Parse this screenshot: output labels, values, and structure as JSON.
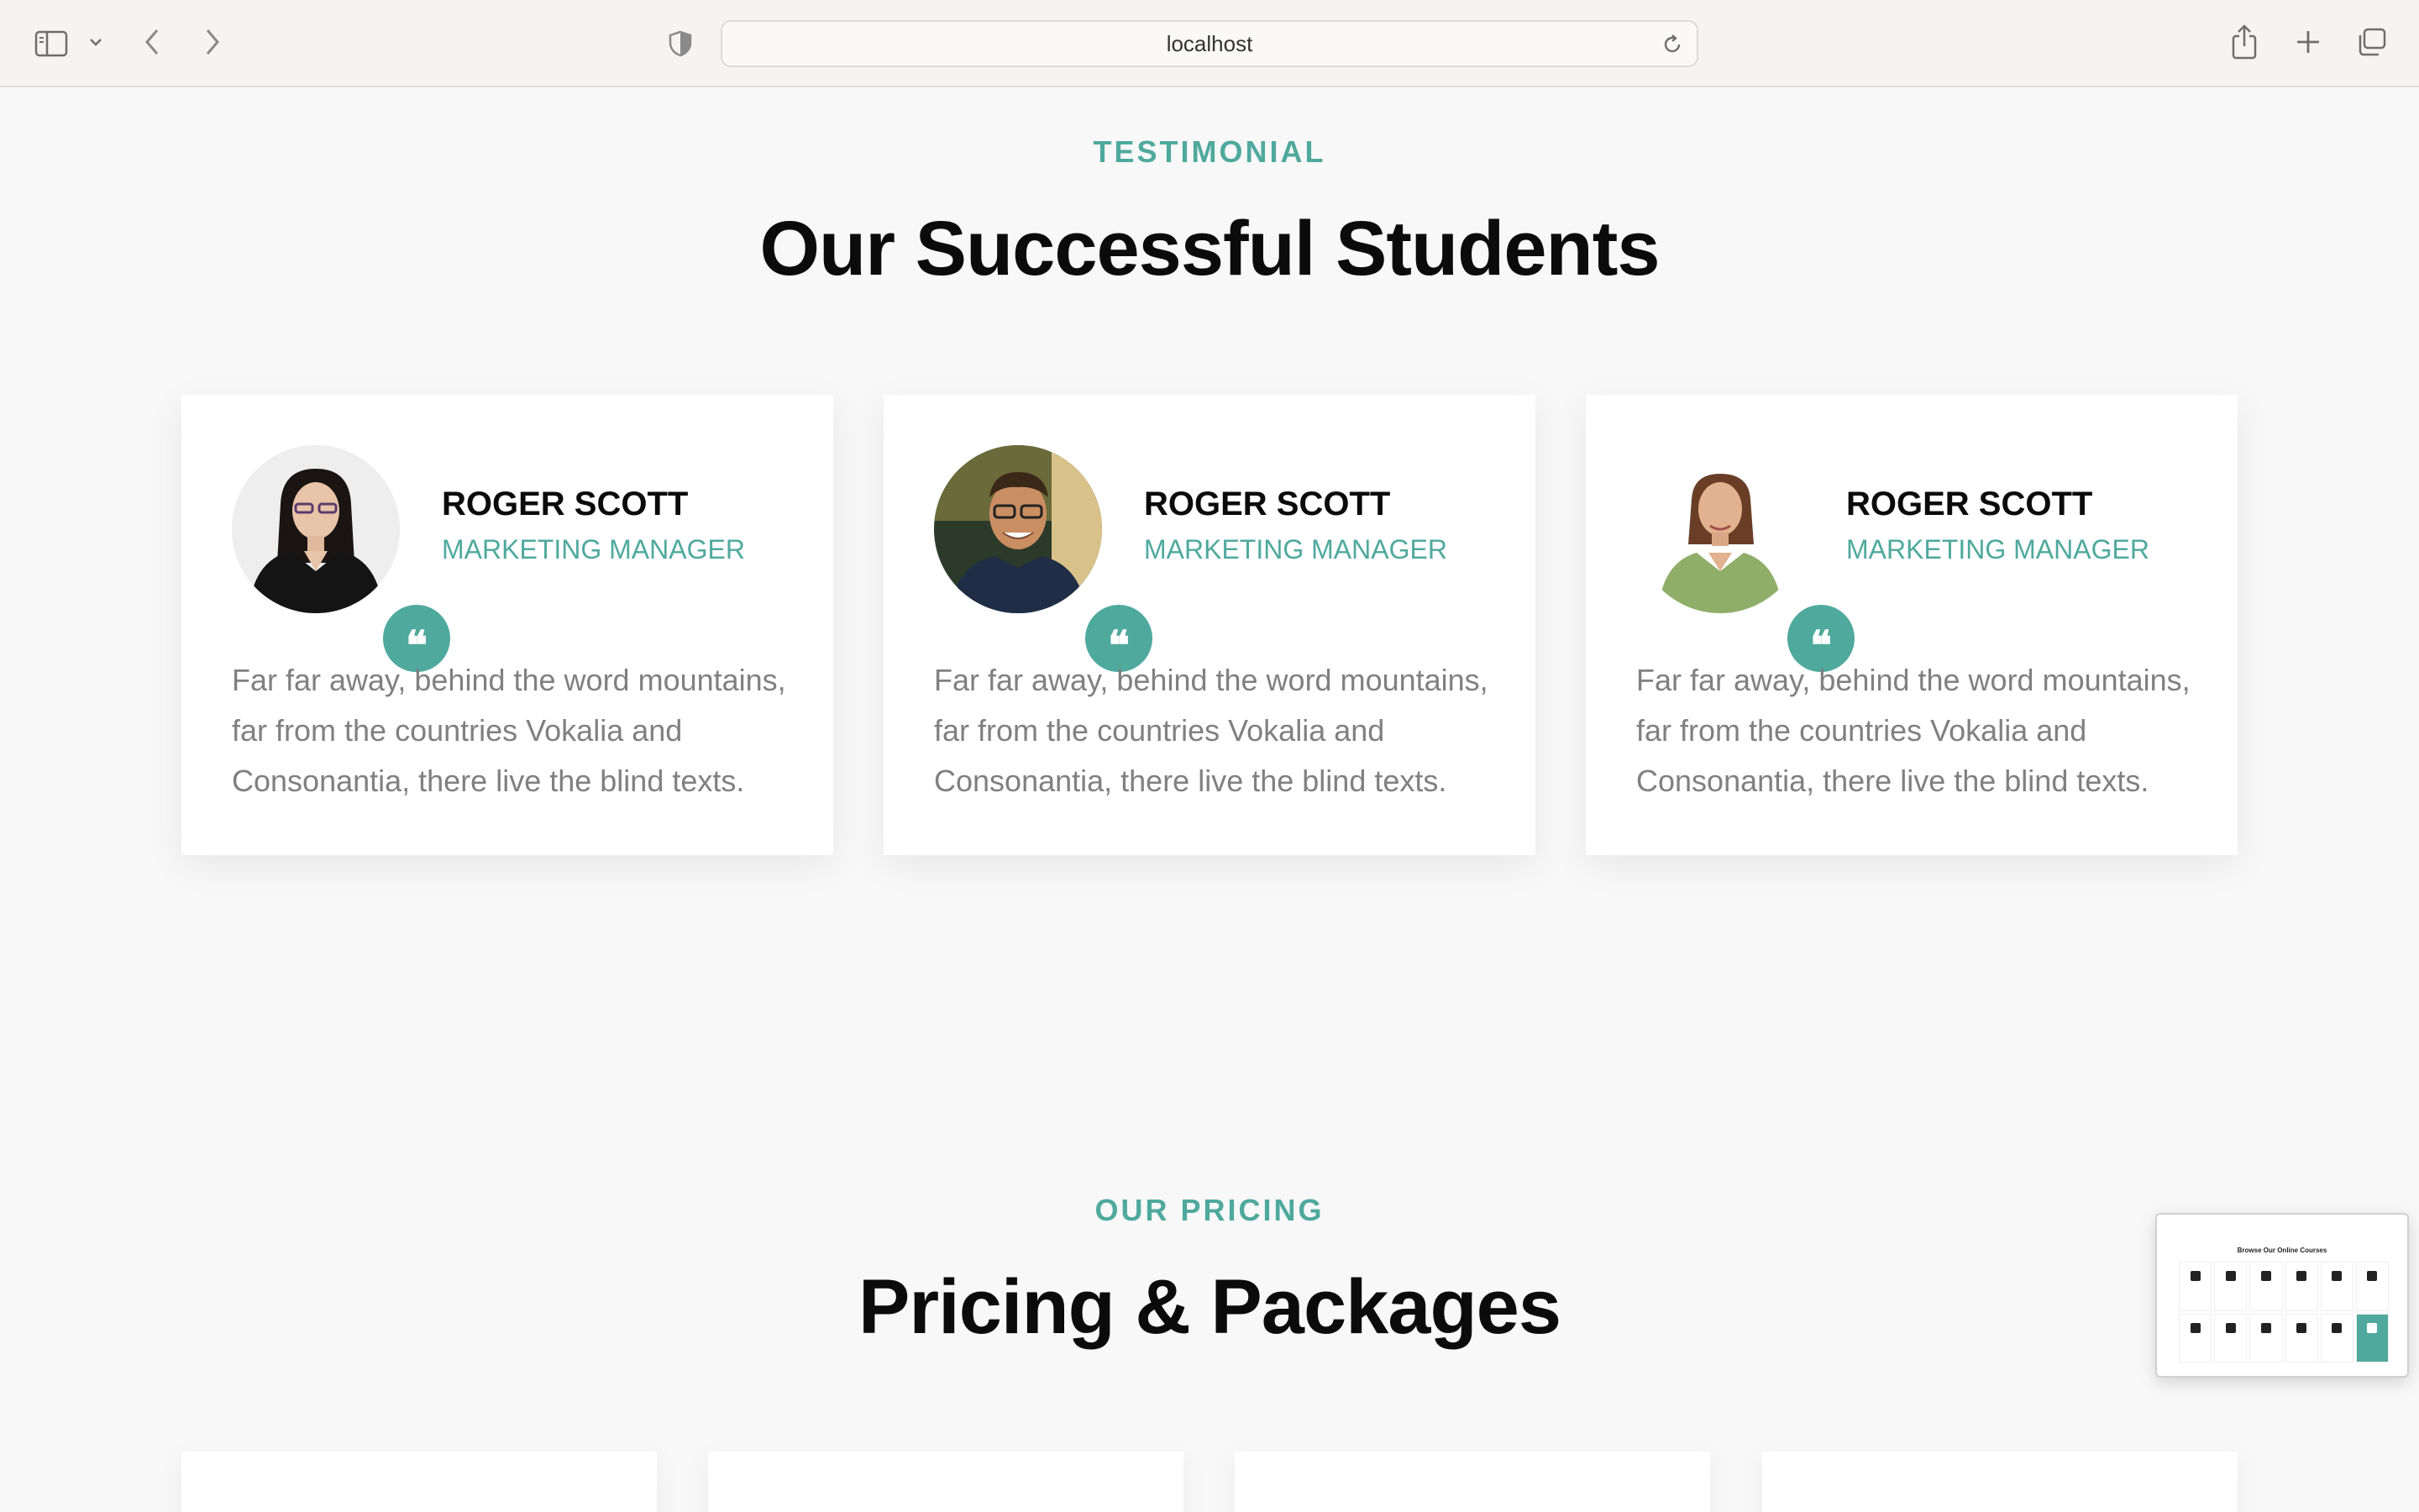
{
  "browser": {
    "url": "localhost",
    "icons": {
      "sidebar": "sidebar-icon",
      "chevron": "chevron-down-icon",
      "back": "back-arrow-icon",
      "forward": "forward-arrow-icon",
      "privacy": "shield-icon",
      "reload": "reload-icon",
      "share": "share-icon",
      "new_tab": "plus-icon",
      "tabs": "tab-overview-icon"
    }
  },
  "testimonial_section": {
    "eyebrow": "TESTIMONIAL",
    "title": "Our Successful Students",
    "cards": [
      {
        "name": "ROGER SCOTT",
        "role": "MARKETING MANAGER",
        "quote_mark": "❝",
        "text": "Far far away, behind the word mountains, far from the countries Vokalia and Consonantia, there live the blind texts."
      },
      {
        "name": "ROGER SCOTT",
        "role": "MARKETING MANAGER",
        "quote_mark": "❝",
        "text": "Far far away, behind the word mountains, far from the countries Vokalia and Consonantia, there live the blind texts."
      },
      {
        "name": "ROGER SCOTT",
        "role": "MARKETING MANAGER",
        "quote_mark": "❝",
        "text": "Far far away, behind the word mountains, far from the countries Vokalia and Consonantia, there live the blind texts."
      }
    ]
  },
  "pricing_section": {
    "eyebrow": "OUR PRICING",
    "title": "Pricing & Packages"
  },
  "thumbnail": {
    "title": "Browse Our Online Courses"
  },
  "colors": {
    "accent": "#4fa99d",
    "heading": "#0b0b0b",
    "body_text": "#808080",
    "page_bg": "#f8f8f8"
  }
}
